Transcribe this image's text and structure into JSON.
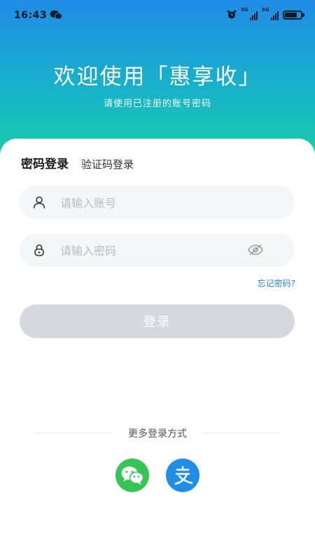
{
  "status_bar": {
    "time": "16:43",
    "signal_1_label": "5G",
    "signal_2_label": "5G",
    "battery_level": 0.75
  },
  "header": {
    "welcome": "欢迎使用「惠享收」",
    "subtitle": "请使用已注册的账号密码"
  },
  "tabs": {
    "password_login": "密码登录",
    "code_login": "验证码登录"
  },
  "form": {
    "account_placeholder": "请输入账号",
    "password_placeholder": "请输入密码",
    "forgot_password": "忘记密码?",
    "login_button": "登录"
  },
  "more": {
    "label": "更多登录方式",
    "options": [
      "wechat-icon",
      "alipay-icon"
    ]
  },
  "colors": {
    "gradient_top": "#1f8ce6",
    "gradient_bottom": "#19d39f",
    "login_disabled": "#d6d8e0",
    "link": "#2b86c8",
    "wechat": "#34c553",
    "alipay": "#1f8ee6"
  }
}
